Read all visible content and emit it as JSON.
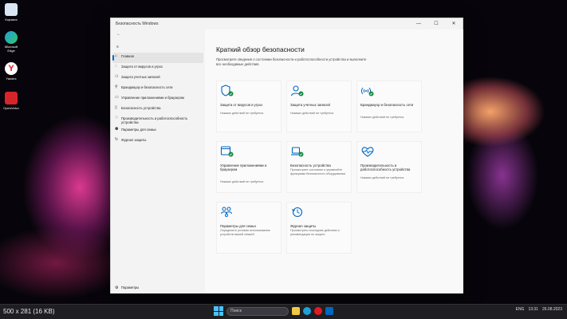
{
  "desktop": {
    "icons": [
      {
        "label": "Корзина",
        "color": "#d9e6f2"
      },
      {
        "label": "Microsoft Edge",
        "color": "#1fa0d8"
      },
      {
        "label": "Yandex",
        "color": "#e11b22"
      },
      {
        "label": "OpenVolvo",
        "color": "#d6252a"
      }
    ]
  },
  "window": {
    "title": "Безопасность Windows",
    "controls": {
      "minimize": "—",
      "maximize": "☐",
      "close": "✕"
    }
  },
  "sidebar": {
    "back": "←",
    "menu": "≡",
    "items": [
      {
        "icon": "⌂",
        "label": "Главная"
      },
      {
        "icon": "◌",
        "label": "Защита от вирусов и угроз"
      },
      {
        "icon": "⚇",
        "label": "Защита учетных записей"
      },
      {
        "icon": "⚲",
        "label": "Брандмауэр и безопасность сети"
      },
      {
        "icon": "▭",
        "label": "Управление приложениями и браузером"
      },
      {
        "icon": "▯",
        "label": "Безопасность устройства"
      },
      {
        "icon": "♡",
        "label": "Производительность и работоспособность устройства"
      },
      {
        "icon": "⚉",
        "label": "Параметры для семьи"
      },
      {
        "icon": "↻",
        "label": "Журнал защиты"
      }
    ],
    "settings": {
      "icon": "⚙",
      "label": "Параметры"
    }
  },
  "main": {
    "title": "Краткий обзор безопасности",
    "description": "Просмотрите сведения о состоянии безопасности и работоспособности устройства и выполните все необходимые действия.",
    "tiles": [
      {
        "title": "Защита от вирусов и угроз",
        "status": "Никаких действий не требуется."
      },
      {
        "title": "Защита учетных записей",
        "status": "Никаких действий не требуется."
      },
      {
        "title": "Брандмауэр и безопасность сети",
        "status": "Никаких действий не требуется."
      },
      {
        "title": "Управление приложениями и браузером",
        "status": "Никаких действий не требуется."
      },
      {
        "title": "Безопасность устройства",
        "status": "Просмотрите состояние и управляйте функциями безопасности оборудования"
      },
      {
        "title": "Производительность и работоспособность устройства",
        "status": "Никаких действий не требуется."
      },
      {
        "title": "Параметры для семьи",
        "status": "Определите условия использования устройств вашей семьей."
      },
      {
        "title": "Журнал защиты",
        "status": "Просмотреть последние действия и рекомендации по защите"
      }
    ],
    "accent_color": "#0067c0",
    "ok_color": "#10893e"
  },
  "taskbar": {
    "image_note": "500 x 281 (16 KB)",
    "search_label": "Поиск",
    "tray": {
      "lang": "ENG",
      "time": "13:31",
      "date": "26.08.2023"
    }
  }
}
